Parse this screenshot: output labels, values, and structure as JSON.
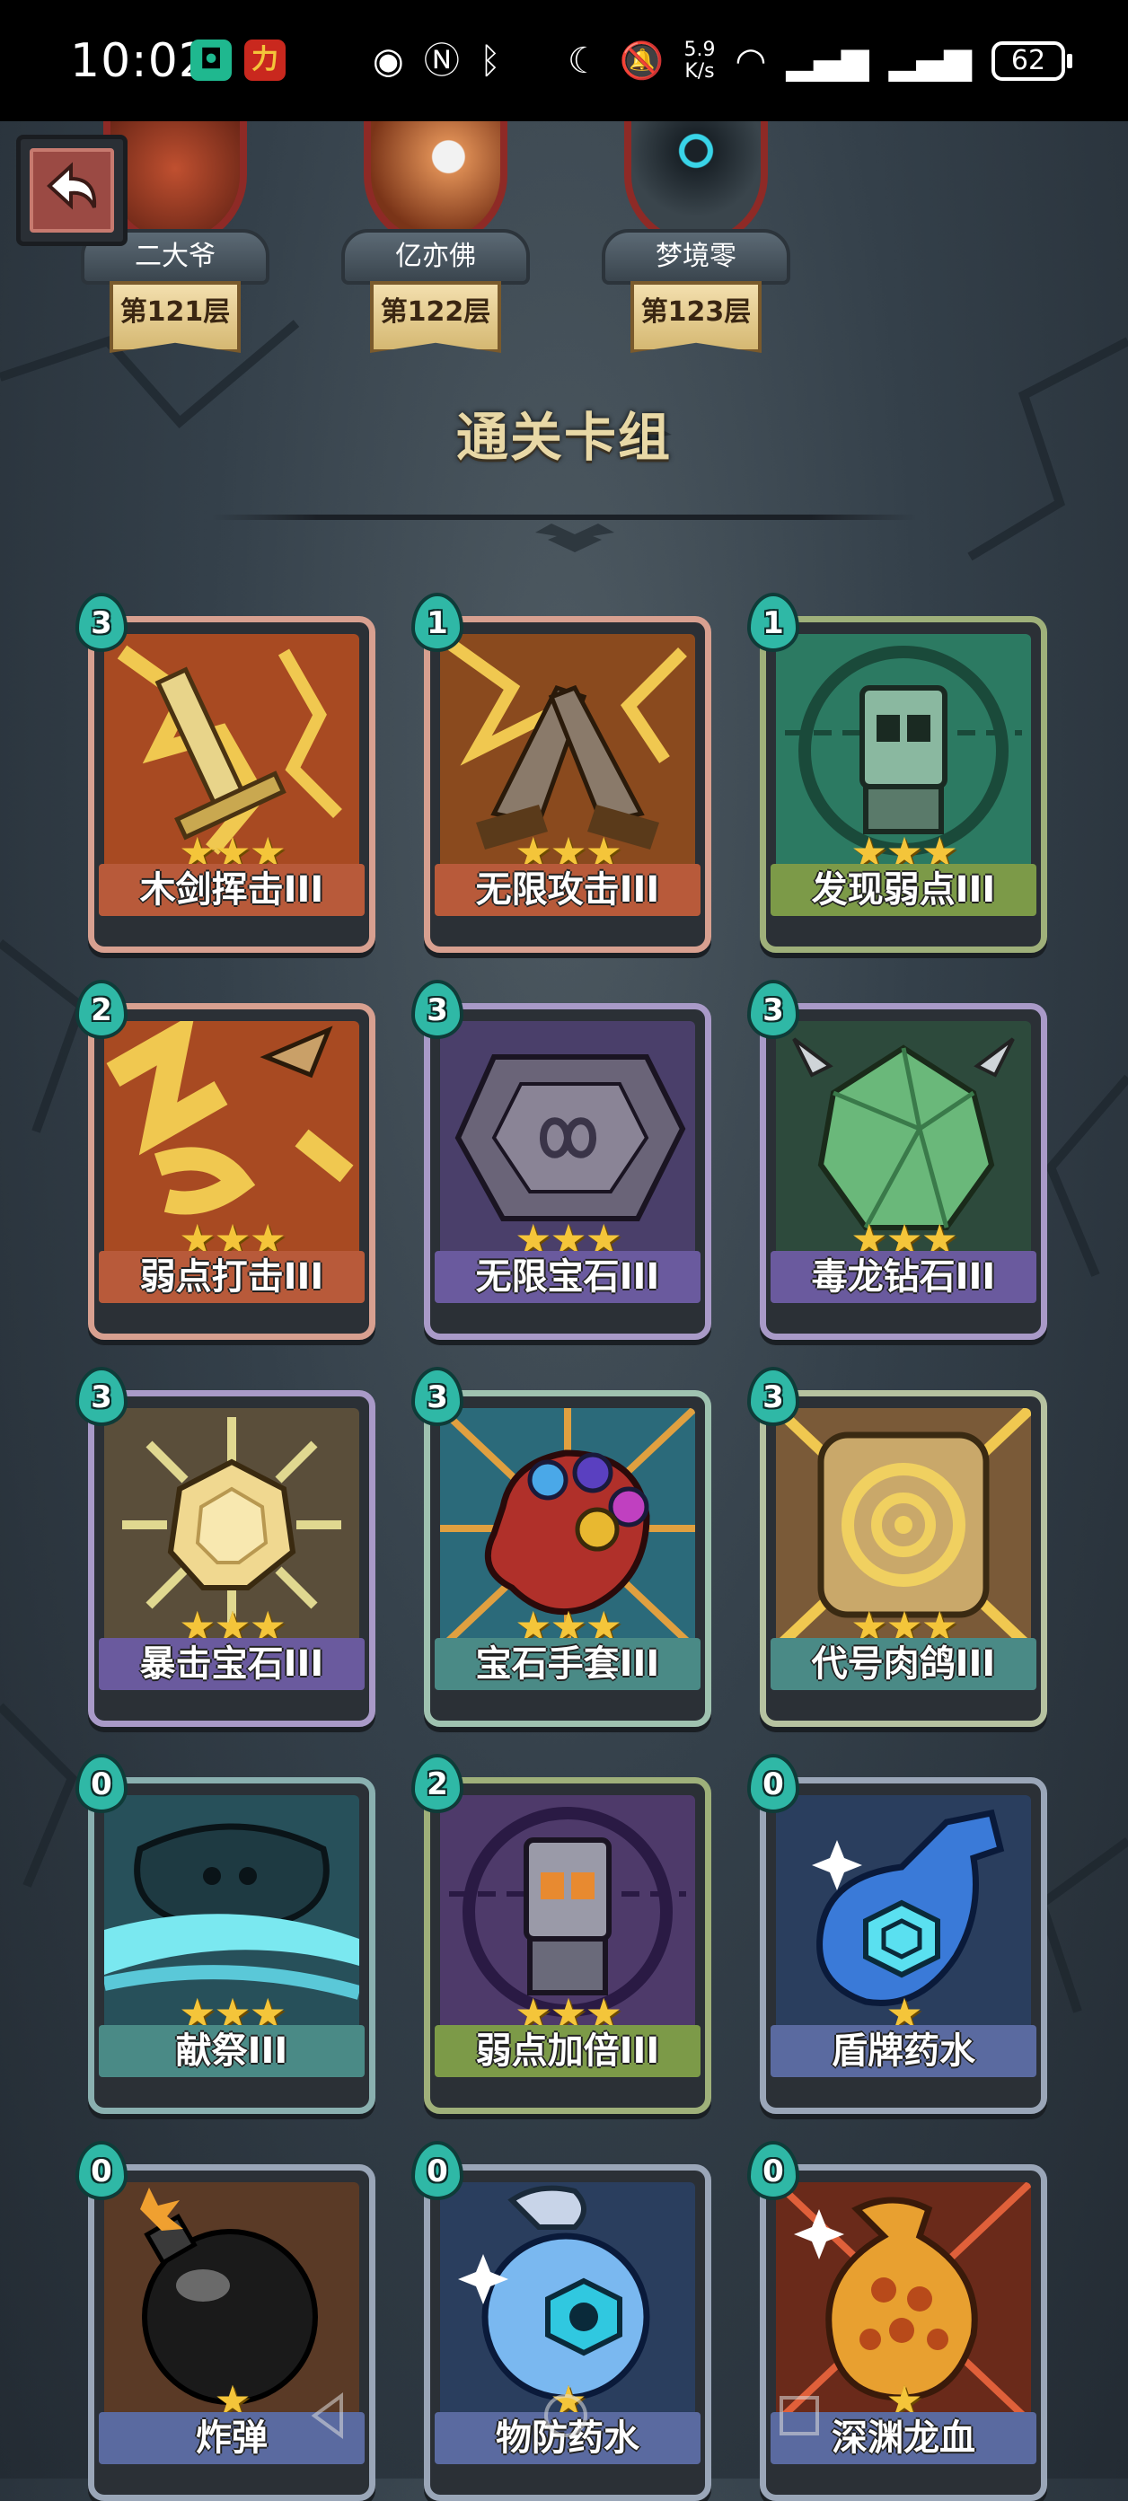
{
  "status_bar": {
    "time": "10:02",
    "net_speed_value": "5.9",
    "net_speed_unit": "K/s",
    "battery": "62"
  },
  "players": [
    {
      "name": "二大爷",
      "floor": "第121层"
    },
    {
      "name": "亿亦佛",
      "floor": "第122层"
    },
    {
      "name": "梦境零",
      "floor": "第123层"
    }
  ],
  "section_title": "通关卡组",
  "cards": [
    {
      "name": "木剑挥击III",
      "cost": "3",
      "stars": 3,
      "plate_color": "#b85a3a",
      "frame_color": "#d8a090",
      "art": "sword-icon",
      "art_bg": "#a84a22"
    },
    {
      "name": "无限攻击III",
      "cost": "1",
      "stars": 3,
      "plate_color": "#b85a3a",
      "frame_color": "#d8a090",
      "art": "crossed-swords-icon",
      "art_bg": "#8a4a1e"
    },
    {
      "name": "发现弱点III",
      "cost": "1",
      "stars": 3,
      "plate_color": "#7c9a48",
      "frame_color": "#9fb07a",
      "art": "robot-target-icon",
      "art_bg": "#2c7a62"
    },
    {
      "name": "弱点打击III",
      "cost": "2",
      "stars": 3,
      "plate_color": "#b85a3a",
      "frame_color": "#d8a090",
      "art": "dagger-strike-icon",
      "art_bg": "#a84a22"
    },
    {
      "name": "无限宝石III",
      "cost": "3",
      "stars": 3,
      "plate_color": "#6a5a9e",
      "frame_color": "#a99ac8",
      "art": "infinity-gem-icon",
      "art_bg": "#4a3f6a"
    },
    {
      "name": "毒龙钻石III",
      "cost": "3",
      "stars": 3,
      "plate_color": "#6a5a9e",
      "frame_color": "#a99ac8",
      "art": "dragon-gem-icon",
      "art_bg": "#2d4a3c"
    },
    {
      "name": "暴击宝石III",
      "cost": "3",
      "stars": 3,
      "plate_color": "#6a5a9e",
      "frame_color": "#a99ac8",
      "art": "crit-gem-icon",
      "art_bg": "#5a4e3a"
    },
    {
      "name": "宝石手套III",
      "cost": "3",
      "stars": 3,
      "plate_color": "#4a8a86",
      "frame_color": "#9fc2b0",
      "art": "gem-gauntlet-icon",
      "art_bg": "#2b6a7a"
    },
    {
      "name": "代号肉鸽III",
      "cost": "3",
      "stars": 3,
      "plate_color": "#4a8a86",
      "frame_color": "#b6c2a0",
      "art": "roguelike-disc-icon",
      "art_bg": "#7a5a38"
    },
    {
      "name": "献祭III",
      "cost": "0",
      "stars": 3,
      "plate_color": "#4a8a86",
      "frame_color": "#8ab0b0",
      "art": "sacrifice-icon",
      "art_bg": "#27505a"
    },
    {
      "name": "弱点加倍III",
      "cost": "2",
      "stars": 3,
      "plate_color": "#7c9a48",
      "frame_color": "#9fb07a",
      "art": "robot-double-icon",
      "art_bg": "#4e3a6a"
    },
    {
      "name": "盾牌药水",
      "cost": "0",
      "stars": 1,
      "plate_color": "#5a6aa0",
      "frame_color": "#9aa6b8",
      "art": "shield-potion-icon",
      "art_bg": "#2a3e5e"
    },
    {
      "name": "炸弹",
      "cost": "0",
      "stars": 1,
      "plate_color": "#5a6aa0",
      "frame_color": "#9aa6b8",
      "art": "bomb-icon",
      "art_bg": "#5a3a26"
    },
    {
      "name": "物防药水",
      "cost": "0",
      "stars": 1,
      "plate_color": "#5a6aa0",
      "frame_color": "#9aa6b8",
      "art": "armor-potion-icon",
      "art_bg": "#2a3e5e"
    },
    {
      "name": "深渊龙血",
      "cost": "0",
      "stars": 1,
      "plate_color": "#5a6aa0",
      "frame_color": "#9aa6b8",
      "art": "dragon-blood-icon",
      "art_bg": "#6a2a1a"
    }
  ]
}
